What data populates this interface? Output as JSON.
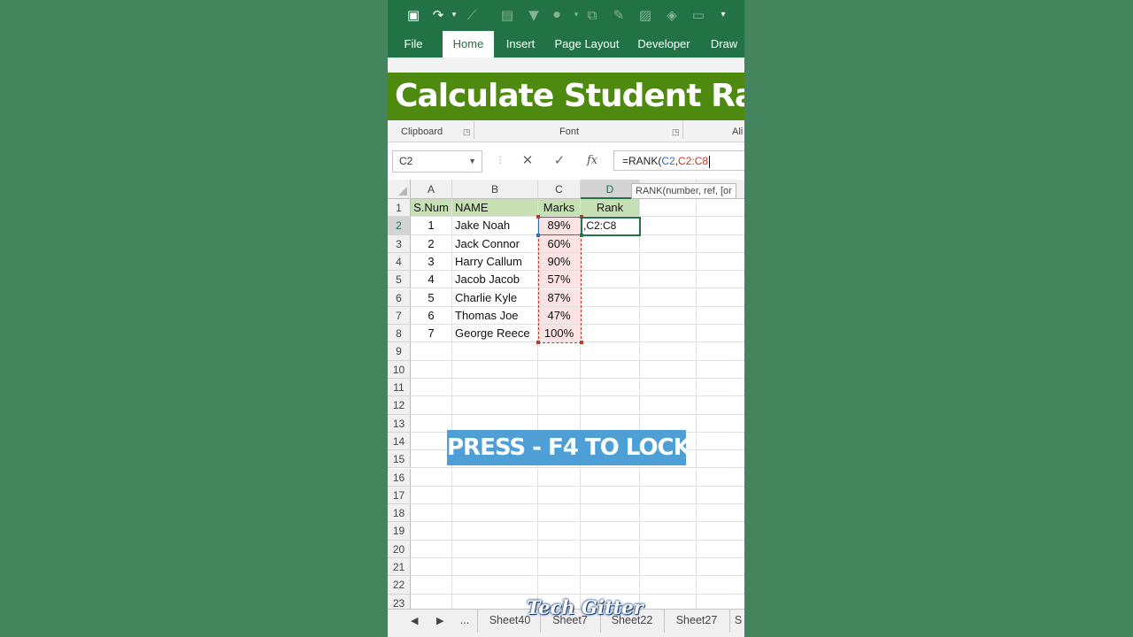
{
  "ribbon": {
    "tabs": [
      "File",
      "Home",
      "Insert",
      "Page Layout",
      "Developer",
      "Draw"
    ],
    "active_tab": "Home",
    "groups": [
      "Clipboard",
      "Font",
      "Ali"
    ]
  },
  "overlay": {
    "title": "Calculate Student Rank",
    "hint": "PRESS - F4 TO LOCK",
    "watermark": "Tech Gitter"
  },
  "formula_bar": {
    "name_box": "C2",
    "prefix": "=RANK(",
    "arg1": "C2",
    "comma": ",",
    "arg2": "C2:C8",
    "tooltip": "RANK(number, ref, [or"
  },
  "columns": [
    "A",
    "B",
    "C",
    "D"
  ],
  "rows": [
    "1",
    "2",
    "3",
    "4",
    "5",
    "6",
    "7",
    "8",
    "9",
    "10",
    "11",
    "12",
    "13",
    "14",
    "15",
    "16",
    "17",
    "18",
    "19",
    "20",
    "21",
    "22",
    "23"
  ],
  "table": {
    "headers": [
      "S.Num",
      "NAME",
      "Marks",
      "Rank"
    ],
    "records": [
      [
        "1",
        "Jake Noah",
        "89%"
      ],
      [
        "2",
        "Jack Connor",
        "60%"
      ],
      [
        "3",
        "Harry Callum",
        "90%"
      ],
      [
        "4",
        "Jacob  Jacob",
        "57%"
      ],
      [
        "5",
        "Charlie Kyle",
        "87%"
      ],
      [
        "6",
        "Thomas Joe",
        "47%"
      ],
      [
        "7",
        "George Reece",
        "100%"
      ]
    ],
    "editing_cell_text": ",C2:C8"
  },
  "sheet_tabs": [
    "...",
    "Sheet40",
    "Sheet7",
    "Sheet22",
    "Sheet27",
    "S"
  ],
  "colors": {
    "excel_green": "#217346",
    "title_banner": "#4f8a10",
    "hint_banner": "#4e9fd6",
    "header_fill": "#c6e0b4",
    "marks_fill": "#fbe3e3",
    "background": "#44855d"
  }
}
